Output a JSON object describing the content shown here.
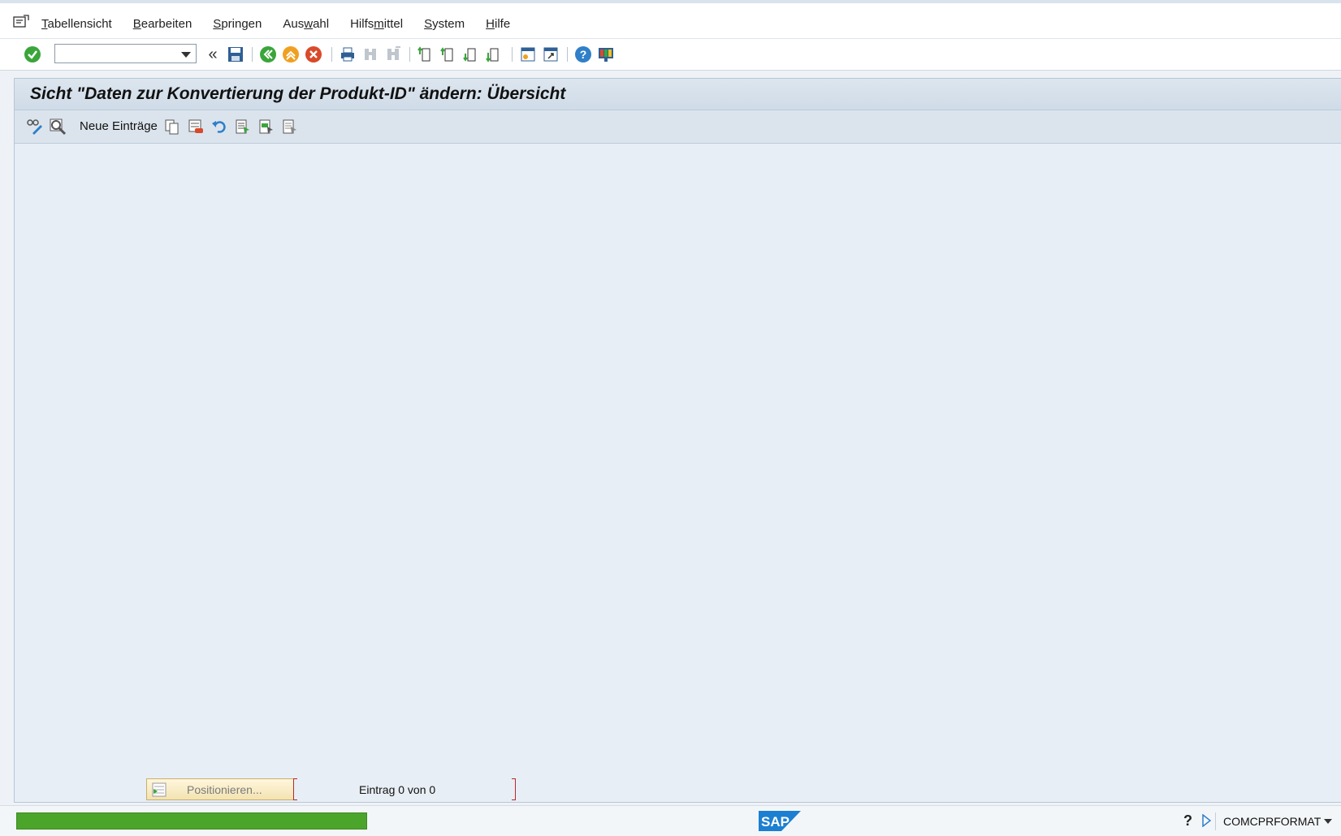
{
  "menu": {
    "items": [
      {
        "pre": "",
        "u": "T",
        "post": "abellensicht"
      },
      {
        "pre": "",
        "u": "B",
        "post": "earbeiten"
      },
      {
        "pre": "",
        "u": "S",
        "post": "pringen"
      },
      {
        "pre": "Aus",
        "u": "w",
        "post": "ahl"
      },
      {
        "pre": "Hilfs",
        "u": "m",
        "post": "ittel"
      },
      {
        "pre": "",
        "u": "S",
        "post": "ystem"
      },
      {
        "pre": "",
        "u": "H",
        "post": "ilfe"
      }
    ]
  },
  "toolbar": {
    "command_field_value": ""
  },
  "screen": {
    "title": "Sicht \"Daten zur Konvertierung der Produkt-ID\" ändern: Übersicht",
    "new_entries_label": "Neue Einträge"
  },
  "footer": {
    "position_button_label": "Positionieren...",
    "entry_status": "Eintrag 0 von 0"
  },
  "statusbar": {
    "progress": 1.0,
    "sap_logo_text": "SAP",
    "transaction": "COMCPRFORMAT"
  },
  "colors": {
    "progress_green": "#4ba52a",
    "sap_blue": "#1c7fd1"
  }
}
